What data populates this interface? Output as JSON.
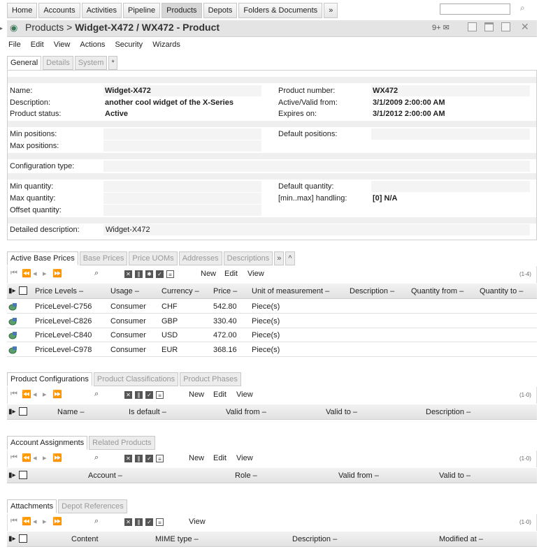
{
  "nav": {
    "tabs": [
      "Home",
      "Accounts",
      "Activities",
      "Pipeline",
      "Products",
      "Depots",
      "Folders & Documents",
      "»"
    ],
    "active": 4
  },
  "title": {
    "section": "Products >",
    "object": "Widget-X472 / WX472 - Product",
    "badge": "9+"
  },
  "menu": [
    "File",
    "Edit",
    "View",
    "Actions",
    "Security",
    "Wizards"
  ],
  "detail_tabs": [
    "General",
    "Details",
    "System",
    "*"
  ],
  "general": {
    "name_label": "Name:",
    "name": "Widget-X472",
    "description_label": "Description:",
    "description": "another cool widget of the X-Series",
    "status_label": "Product status:",
    "status": "Active",
    "number_label": "Product number:",
    "number": "WX472",
    "valid_from_label": "Active/Valid from:",
    "valid_from": "3/1/2009 2:00:00 AM",
    "expires_label": "Expires on:",
    "expires": "3/1/2012 2:00:00 AM",
    "min_positions_label": "Min positions:",
    "max_positions_label": "Max positions:",
    "default_positions_label": "Default positions:",
    "config_type_label": "Configuration type:",
    "min_qty_label": "Min quantity:",
    "max_qty_label": "Max quantity:",
    "offset_qty_label": "Offset quantity:",
    "default_qty_label": "Default quantity:",
    "handling_label": "[min..max] handling:",
    "handling": "[0] N/A",
    "detailed_desc_label": "Detailed description:",
    "detailed_desc": "Widget-X472"
  },
  "prices": {
    "tabs": [
      "Active Base Prices",
      "Base Prices",
      "Price UOMs",
      "Addresses",
      "Descriptions",
      "»",
      "^"
    ],
    "toolbar": {
      "new": "New",
      "edit": "Edit",
      "view": "View",
      "count": "(1-4)"
    },
    "columns": [
      "Price Levels",
      "Usage",
      "Currency",
      "Price",
      "Unit of measurement",
      "Description",
      "Quantity from",
      "Quantity to"
    ],
    "rows": [
      {
        "level": "PriceLevel-C756",
        "usage": "Consumer",
        "currency": "CHF",
        "price": "542.80",
        "uom": "Piece(s)"
      },
      {
        "level": "PriceLevel-C826",
        "usage": "Consumer",
        "currency": "GBP",
        "price": "330.40",
        "uom": "Piece(s)"
      },
      {
        "level": "PriceLevel-C840",
        "usage": "Consumer",
        "currency": "USD",
        "price": "472.00",
        "uom": "Piece(s)"
      },
      {
        "level": "PriceLevel-C978",
        "usage": "Consumer",
        "currency": "EUR",
        "price": "368.16",
        "uom": "Piece(s)"
      }
    ]
  },
  "configs": {
    "tabs": [
      "Product Configurations",
      "Product Classifications",
      "Product Phases"
    ],
    "toolbar": {
      "new": "New",
      "edit": "Edit",
      "view": "View",
      "count": "(1-0)"
    },
    "columns": [
      "Name",
      "Is default",
      "Valid from",
      "Valid to",
      "Description"
    ]
  },
  "accounts": {
    "tabs": [
      "Account Assignments",
      "Related Products"
    ],
    "toolbar": {
      "new": "New",
      "edit": "Edit",
      "view": "View",
      "count": "(1-0)"
    },
    "columns": [
      "Account",
      "Role",
      "Valid from",
      "Valid to"
    ]
  },
  "attachments": {
    "tabs": [
      "Attachments",
      "Depot References"
    ],
    "toolbar": {
      "view": "View",
      "count": "(1-0)"
    },
    "columns": [
      "Content",
      "MIME type",
      "Description",
      "Modified at"
    ]
  }
}
